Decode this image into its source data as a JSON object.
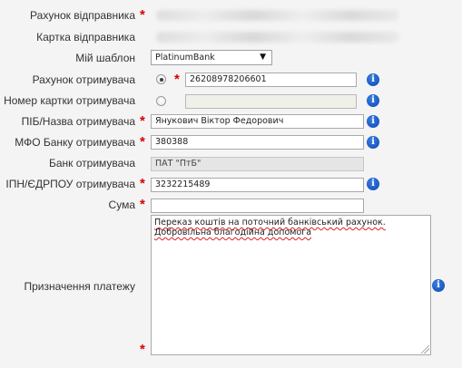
{
  "form": {
    "sender_account": {
      "label": "Рахунок відправника"
    },
    "sender_card": {
      "label": "Картка відправника"
    },
    "template": {
      "label": "Мій шаблон",
      "selected": "PlatinumBank"
    },
    "recipient_account": {
      "label": "Рахунок отримувача",
      "value": "26208978206601"
    },
    "recipient_card": {
      "label": "Номер картки отримувача",
      "value": ""
    },
    "recipient_name": {
      "label": "ПІБ/Назва отримувача",
      "value": "Янукович Віктор Федорович"
    },
    "bank_mfo": {
      "label": "МФО Банку отримувача",
      "value": "380388"
    },
    "recipient_bank": {
      "label": "Банк отримувача",
      "value": "ПАТ \"ПтБ\""
    },
    "tax_id": {
      "label": "ІПН/ЄДРПОУ отримувача",
      "value": "3232215489"
    },
    "amount": {
      "label": "Сума",
      "value": ""
    },
    "purpose": {
      "label": "Призначення платежу",
      "value": "Переказ коштів на поточний банківський рахунок. Добровільна благодійна допомога"
    }
  },
  "required_mark": "*",
  "info_glyph": "i",
  "select_arrow": "▼",
  "colors": {
    "required": "#d40000",
    "info": "#0a47b8",
    "background": "#f4f4f4"
  }
}
